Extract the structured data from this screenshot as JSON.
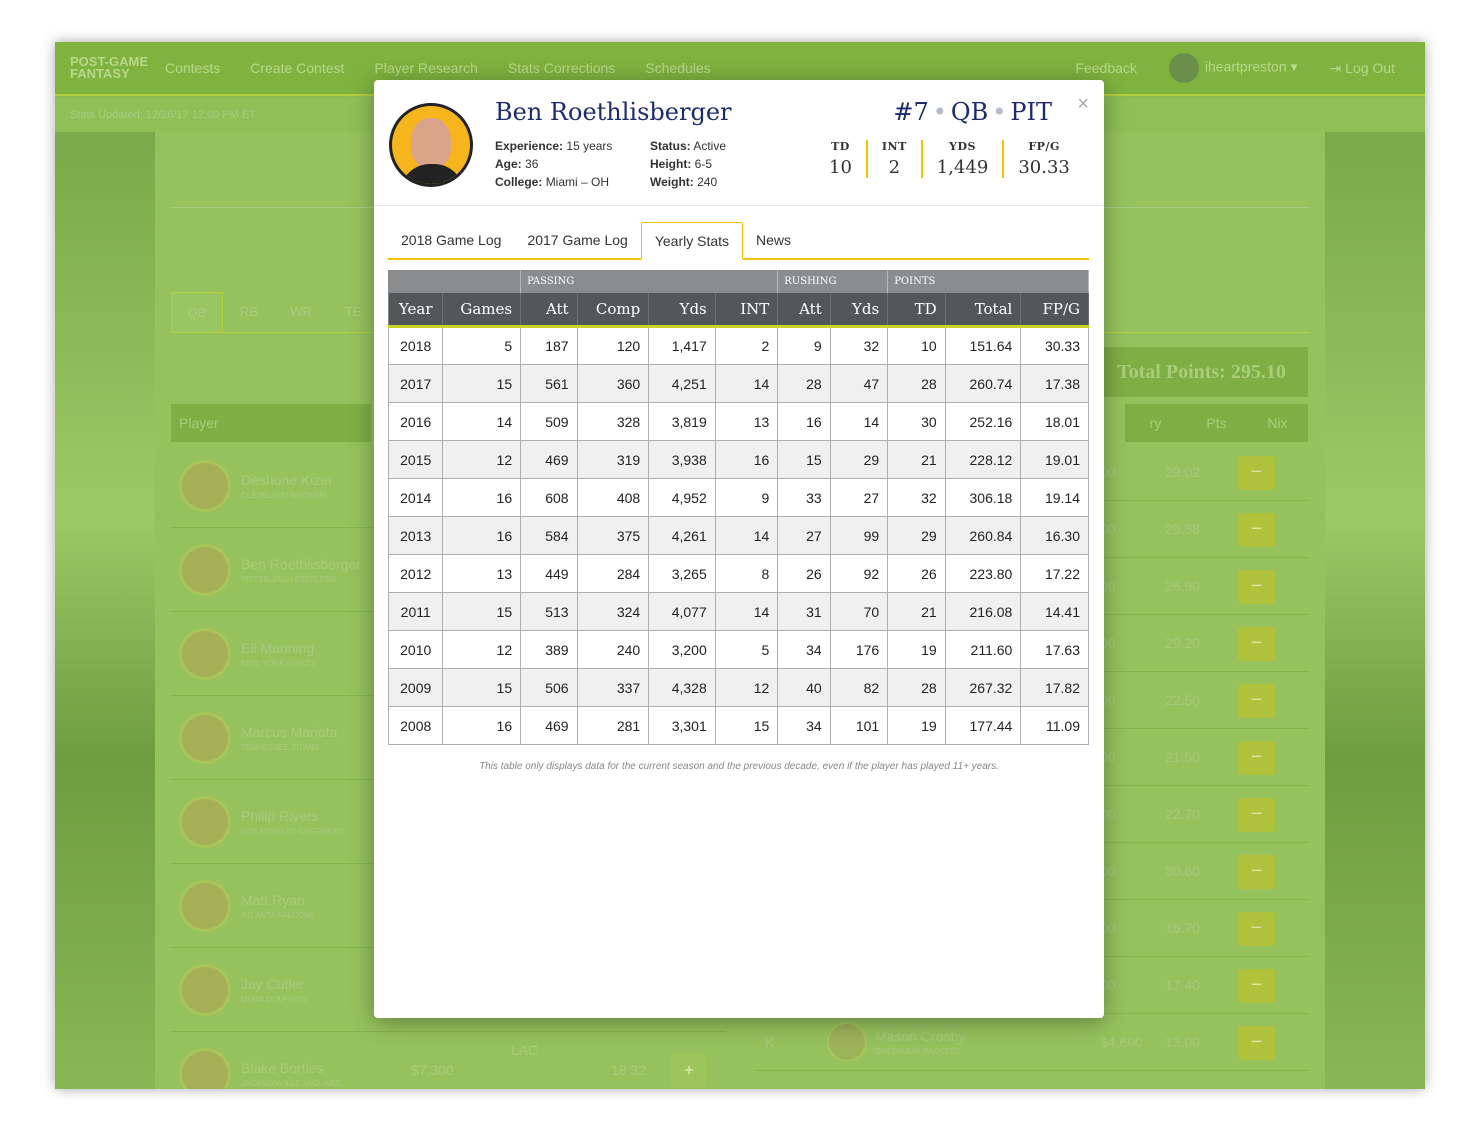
{
  "bg": {
    "logo_line1": "POST-GAME",
    "logo_line2": "FANTASY",
    "nav": [
      "Contests",
      "Create Contest",
      "Player Research",
      "Stats Corrections",
      "Schedules"
    ],
    "feedback": "Feedback",
    "username": "iheartpreston",
    "logout": "Log Out",
    "stats_updated": "Stats Updated: 12/26/17 12:00 PM ET",
    "positions": [
      "QB",
      "RB",
      "WR",
      "TE"
    ],
    "total_points": "Total Points: 295.10",
    "left_header": "Player",
    "right_header": [
      "ry",
      "Pts",
      "Nix"
    ],
    "left_players": [
      {
        "name": "Deshone Kizer",
        "team": "CLEVELAND BROWNS"
      },
      {
        "name": "Ben Roethlisberger",
        "team": "PITTSBURGH STEELERS"
      },
      {
        "name": "Eli Manning",
        "team": "NEW YORK GIANTS"
      },
      {
        "name": "Marcus Mariota",
        "team": "TENNESSEE TITANS"
      },
      {
        "name": "Philip Rivers",
        "team": "LOS ANGELES CHARGERS"
      },
      {
        "name": "Matt Ryan",
        "team": "ATLANTA FALCONS"
      },
      {
        "name": "Jay Cutler",
        "team": "MIAMI DOLPHINS"
      },
      {
        "name": "Blake Bortles",
        "team": "JACKSONVILLE JAGUARS",
        "salary": "$7,300",
        "opp": "LAC",
        "fpts": "18.32"
      }
    ],
    "right_rows": [
      {
        "rest": "00",
        "pts": "29.02"
      },
      {
        "rest": "00",
        "pts": "29.58"
      },
      {
        "rest": "00",
        "pts": "26.90"
      },
      {
        "rest": "00",
        "pts": "29.20"
      },
      {
        "rest": "00",
        "pts": "22.50"
      },
      {
        "rest": "00",
        "pts": "21.50"
      },
      {
        "rest": "00",
        "pts": "22.70"
      },
      {
        "rest": "00",
        "pts": "30.60"
      },
      {
        "rest": "00",
        "pts": "16.70"
      },
      {
        "rest": "00",
        "pts": "17.40"
      },
      {
        "pos": "K",
        "name": "Mason Crosby",
        "team": "GREEN BAY PACKERS",
        "rest": "$4,600",
        "pts": "13.00"
      }
    ],
    "add_label": "+",
    "nix_label": "−"
  },
  "modal": {
    "name": "Ben Roethlisberger",
    "number": "#7",
    "position": "QB",
    "team": "PIT",
    "separator": "•",
    "close": "×",
    "experience_label": "Experience:",
    "experience": "15 years",
    "age_label": "Age:",
    "age": "36",
    "college_label": "College:",
    "college": "Miami – OH",
    "status_label": "Status:",
    "status": "Active",
    "height_label": "Height:",
    "height": "6-5",
    "weight_label": "Weight:",
    "weight": "240",
    "summary": [
      {
        "label": "TD",
        "value": "10"
      },
      {
        "label": "INT",
        "value": "2"
      },
      {
        "label": "YDS",
        "value": "1,449"
      },
      {
        "label": "FP/G",
        "value": "30.33"
      }
    ],
    "tabs": [
      "2018 Game Log",
      "2017 Game Log",
      "Yearly Stats",
      "News"
    ],
    "active_tab": "Yearly Stats",
    "groups": [
      "PASSING",
      "RUSHING",
      "POINTS"
    ],
    "columns": [
      "Year",
      "Games",
      "Att",
      "Comp",
      "Yds",
      "INT",
      "Att",
      "Yds",
      "TD",
      "Total",
      "FP/G"
    ],
    "rows": [
      [
        "2018",
        "5",
        "187",
        "120",
        "1,417",
        "2",
        "9",
        "32",
        "10",
        "151.64",
        "30.33"
      ],
      [
        "2017",
        "15",
        "561",
        "360",
        "4,251",
        "14",
        "28",
        "47",
        "28",
        "260.74",
        "17.38"
      ],
      [
        "2016",
        "14",
        "509",
        "328",
        "3,819",
        "13",
        "16",
        "14",
        "30",
        "252.16",
        "18.01"
      ],
      [
        "2015",
        "12",
        "469",
        "319",
        "3,938",
        "16",
        "15",
        "29",
        "21",
        "228.12",
        "19.01"
      ],
      [
        "2014",
        "16",
        "608",
        "408",
        "4,952",
        "9",
        "33",
        "27",
        "32",
        "306.18",
        "19.14"
      ],
      [
        "2013",
        "16",
        "584",
        "375",
        "4,261",
        "14",
        "27",
        "99",
        "29",
        "260.84",
        "16.30"
      ],
      [
        "2012",
        "13",
        "449",
        "284",
        "3,265",
        "8",
        "26",
        "92",
        "26",
        "223.80",
        "17.22"
      ],
      [
        "2011",
        "15",
        "513",
        "324",
        "4,077",
        "14",
        "31",
        "70",
        "21",
        "216.08",
        "14.41"
      ],
      [
        "2010",
        "12",
        "389",
        "240",
        "3,200",
        "5",
        "34",
        "176",
        "19",
        "211.60",
        "17.63"
      ],
      [
        "2009",
        "15",
        "506",
        "337",
        "4,328",
        "12",
        "40",
        "82",
        "28",
        "267.32",
        "17.82"
      ],
      [
        "2008",
        "16",
        "469",
        "281",
        "3,301",
        "15",
        "34",
        "101",
        "19",
        "177.44",
        "11.09"
      ]
    ],
    "note": "This table only displays data for the current season and the previous decade, even if the player has played 11+ years."
  }
}
